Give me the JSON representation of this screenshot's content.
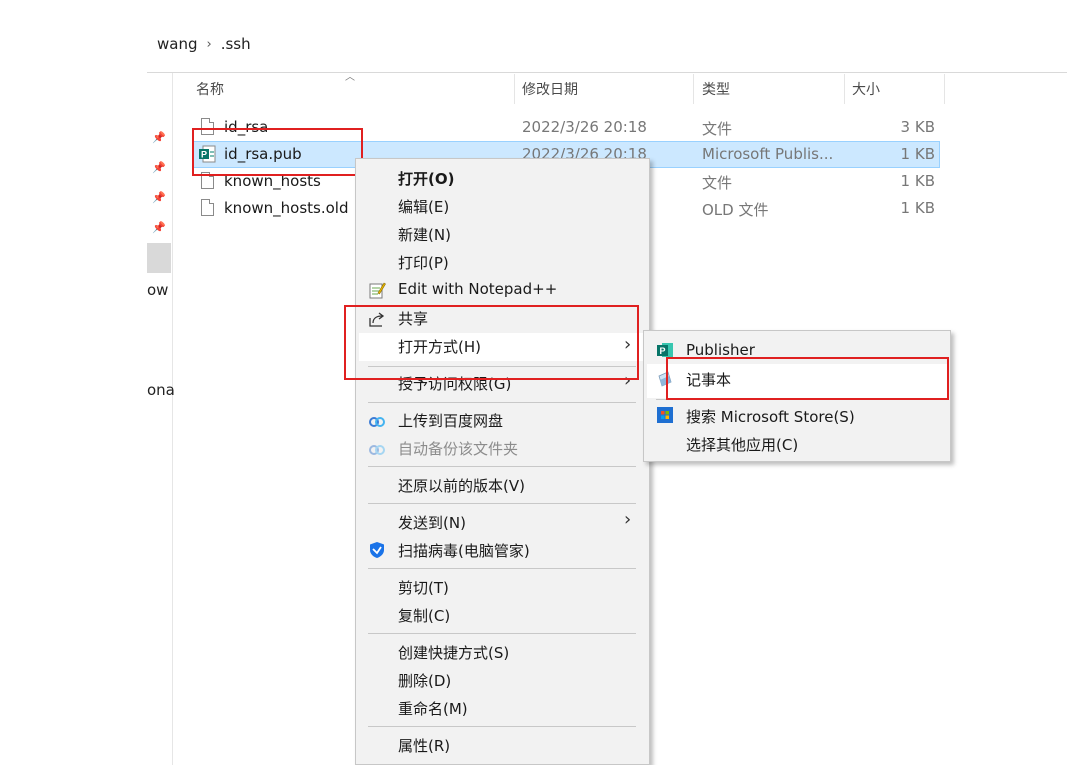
{
  "breadcrumb": {
    "parent": "wang",
    "separator": "›",
    "current": ".ssh"
  },
  "sidebar": {
    "partial_labels": [
      "ow",
      "ona"
    ]
  },
  "columns": {
    "name": "名称",
    "modified": "修改日期",
    "type": "类型",
    "size": "大小"
  },
  "files": [
    {
      "name": "id_rsa",
      "modified": "2022/3/26 20:18",
      "type": "文件",
      "size": "3 KB",
      "icon": "file-icon"
    },
    {
      "name": "id_rsa.pub",
      "modified": "2022/3/26 20:18",
      "type": "Microsoft Publis...",
      "size": "1 KB",
      "icon": "publisher-file-icon",
      "selected": true
    },
    {
      "name": "known_hosts",
      "modified": "",
      "type": "文件",
      "size": "1 KB",
      "icon": "file-icon"
    },
    {
      "name": "known_hosts.old",
      "modified": "",
      "type": "OLD 文件",
      "size": "1 KB",
      "icon": "file-icon"
    }
  ],
  "context_menu": {
    "open": "打开(O)",
    "edit": "编辑(E)",
    "new": "新建(N)",
    "print": "打印(P)",
    "notepadpp": "Edit with Notepad++",
    "share": "共享",
    "open_with": "打开方式(H)",
    "grant_access": "授予访问权限(G)",
    "upload_baidu": "上传到百度网盘",
    "auto_backup": "自动备份该文件夹",
    "restore": "还原以前的版本(V)",
    "send_to": "发送到(N)",
    "scan_virus": "扫描病毒(电脑管家)",
    "cut": "剪切(T)",
    "copy": "复制(C)",
    "shortcut": "创建快捷方式(S)",
    "delete": "删除(D)",
    "rename": "重命名(M)",
    "properties": "属性(R)"
  },
  "submenu": {
    "publisher": "Publisher",
    "notepad": "记事本",
    "store": "搜索 Microsoft Store(S)",
    "other": "选择其他应用(C)"
  },
  "colors": {
    "selection": "#cce8ff",
    "highlight_red": "#e02020",
    "publisher_teal": "#077568"
  }
}
